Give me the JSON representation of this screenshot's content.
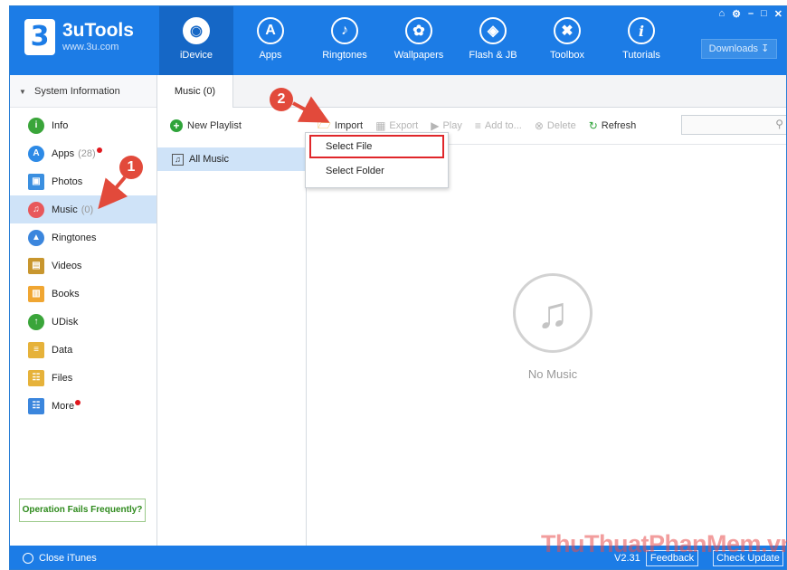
{
  "app": {
    "title": "3uTools",
    "url": "www.3u.com",
    "logo_glyph": "3"
  },
  "nav": {
    "items": [
      {
        "label": "iDevice",
        "icon": "apple-icon",
        "glyph": "",
        "active": true
      },
      {
        "label": "Apps",
        "icon": "app-store-icon",
        "glyph": "A"
      },
      {
        "label": "Ringtones",
        "icon": "bell-icon",
        "glyph": "♪"
      },
      {
        "label": "Wallpapers",
        "icon": "flower-icon",
        "glyph": "✿"
      },
      {
        "label": "Flash & JB",
        "icon": "box-icon",
        "glyph": "◈"
      },
      {
        "label": "Toolbox",
        "icon": "tools-icon",
        "glyph": "✖"
      },
      {
        "label": "Tutorials",
        "icon": "info-icon",
        "glyph": "i"
      }
    ],
    "downloads_label": "Downloads",
    "window_controls": [
      "⌂",
      "⚙",
      "–",
      "□",
      "✕"
    ]
  },
  "sidebar": {
    "header": "System Information",
    "items": [
      {
        "label": "Info",
        "icon": "info-icon",
        "color": "#3aa53a",
        "glyph": "i"
      },
      {
        "label": "Apps",
        "count": "(28)",
        "icon": "apps-icon",
        "color": "#2d8ae6",
        "glyph": "A",
        "dot": true
      },
      {
        "label": "Photos",
        "icon": "photos-icon",
        "color": "#3a8fe0",
        "glyph": "▣"
      },
      {
        "label": "Music",
        "count": "(0)",
        "icon": "music-icon",
        "color": "#e8585b",
        "glyph": "♫",
        "active": true
      },
      {
        "label": "Ringtones",
        "icon": "bell-icon",
        "color": "#3b86dd",
        "glyph": "▲"
      },
      {
        "label": "Videos",
        "icon": "video-icon",
        "color": "#c8962e",
        "glyph": "▤"
      },
      {
        "label": "Books",
        "icon": "book-icon",
        "color": "#f0a632",
        "glyph": "▥"
      },
      {
        "label": "UDisk",
        "icon": "usb-icon",
        "color": "#3aa53a",
        "glyph": "↑"
      },
      {
        "label": "Data",
        "icon": "data-icon",
        "color": "#e6b23a",
        "glyph": "≡"
      },
      {
        "label": "Files",
        "icon": "files-icon",
        "color": "#e6b23a",
        "glyph": "☷"
      },
      {
        "label": "More",
        "icon": "more-icon",
        "color": "#3b86dd",
        "glyph": "☷",
        "dot": true
      }
    ],
    "op_fails": "Operation Fails Frequently?"
  },
  "tab": {
    "label": "Music (0)"
  },
  "playlist": {
    "new_label": "New Playlist",
    "all_label": "All Music"
  },
  "toolbar": {
    "import": "Import",
    "export": "Export",
    "play": "Play",
    "add_to": "Add to...",
    "delete": "Delete",
    "refresh": "Refresh"
  },
  "dropdown": {
    "select_file": "Select File",
    "select_folder": "Select Folder"
  },
  "empty": {
    "text": "No Music"
  },
  "status": {
    "close_itunes": "Close iTunes",
    "version": "V2.31",
    "feedback": "Feedback",
    "check_update": "Check Update"
  },
  "annotations": {
    "step1": "1",
    "step2": "2",
    "color": "#e24a3b"
  },
  "watermark": "ThuThuatPhanMem.vn"
}
